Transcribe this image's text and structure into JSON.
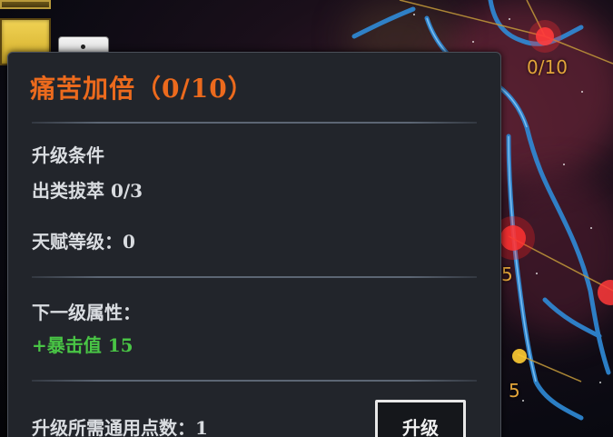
{
  "background": {
    "node_labels": [
      "0/10",
      "5",
      "5"
    ]
  },
  "tooltip": {
    "title": "痛苦加倍（0/10）",
    "requirements_heading": "升级条件",
    "requirement_1": "出类拔萃  0/3",
    "requirement_2": "天赋等级：0",
    "next_level_heading": "下一级属性：",
    "next_level_stat": "+暴击值  15",
    "cost_text": "升级所需通用点数：1",
    "upgrade_button": "升级"
  },
  "colors": {
    "title": "#ec6a1d",
    "stat_bonus": "#49c545",
    "node_label": "#e3a53a",
    "panel_bg": "#22252b"
  }
}
